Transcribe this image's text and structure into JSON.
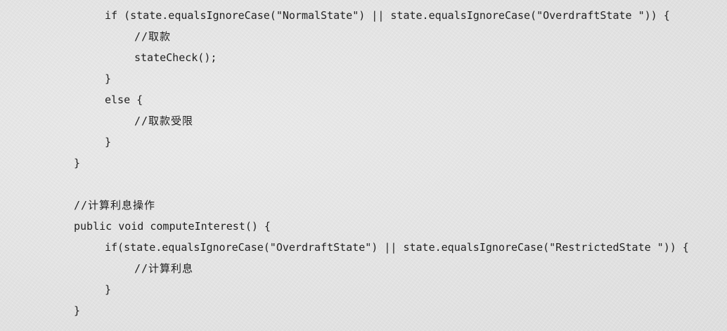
{
  "code": {
    "lines": [
      {
        "text": "if (state.equalsIgnoreCase(\"NormalState\") || state.equalsIgnoreCase(\"OverdraftState \")) {"
      },
      {
        "text": "//取款"
      },
      {
        "text": "stateCheck();"
      },
      {
        "text": "}"
      },
      {
        "text": "else {"
      },
      {
        "text": "//取款受限"
      },
      {
        "text": "}"
      },
      {
        "text": "}"
      },
      {
        "text": ""
      },
      {
        "text": "//计算利息操作"
      },
      {
        "text": "public void computeInterest() {"
      },
      {
        "text": "if(state.equalsIgnoreCase(\"OverdraftState\") || state.equalsIgnoreCase(\"RestrictedState \")) {"
      },
      {
        "text": "//计算利息"
      },
      {
        "text": "}"
      },
      {
        "text": "}"
      }
    ]
  }
}
